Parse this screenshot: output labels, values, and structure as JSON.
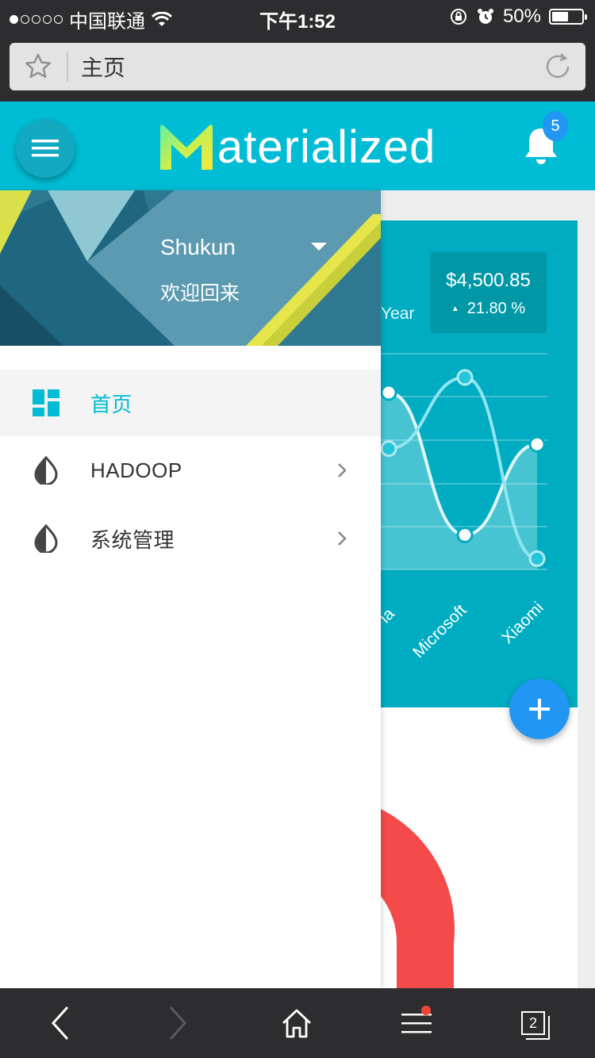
{
  "status_bar": {
    "carrier": "中国联通",
    "time": "下午1:52",
    "battery": "50%",
    "battery_level": 0.5
  },
  "browser": {
    "address_text": "主页",
    "icons": [
      "star-icon",
      "reload-icon"
    ]
  },
  "app_bar": {
    "logo_initial": "M",
    "logo_rest": "aterialized",
    "notification_count": "5",
    "icons": [
      "menu-icon",
      "bell-icon"
    ]
  },
  "drawer": {
    "user_name": "Shukun",
    "welcome": "欢迎回来",
    "items": [
      {
        "label": "首页",
        "icon": "dashboard-icon",
        "active": true
      },
      {
        "label": "HADOOP",
        "icon": "drop-icon",
        "active": false
      },
      {
        "label": "系统管理",
        "icon": "drop-icon",
        "active": false
      }
    ]
  },
  "card": {
    "year_label": "Year",
    "stat_value": "$4,500.85",
    "stat_change": "21.80 %",
    "x_labels": [
      "ia",
      "Microsoft",
      "Xiaomi"
    ]
  },
  "chart_data": {
    "type": "line",
    "categories": [
      "ia",
      "Microsoft",
      "Xiaomi"
    ],
    "series": [
      {
        "values": [
          0.82,
          0.16,
          0.58
        ]
      },
      {
        "values": [
          0.56,
          0.89,
          0.05
        ]
      }
    ],
    "ylim": [
      0,
      1
    ],
    "grid": true
  },
  "toolbar": {
    "tabs_count": "2",
    "icons": [
      "back-icon",
      "forward-icon",
      "home-icon",
      "menu-icon",
      "tabs-icon"
    ]
  },
  "colors": {
    "primary": "#00bcd4",
    "card": "#00acc1",
    "accent": "#2196f3",
    "donut": "#f44a4a"
  }
}
